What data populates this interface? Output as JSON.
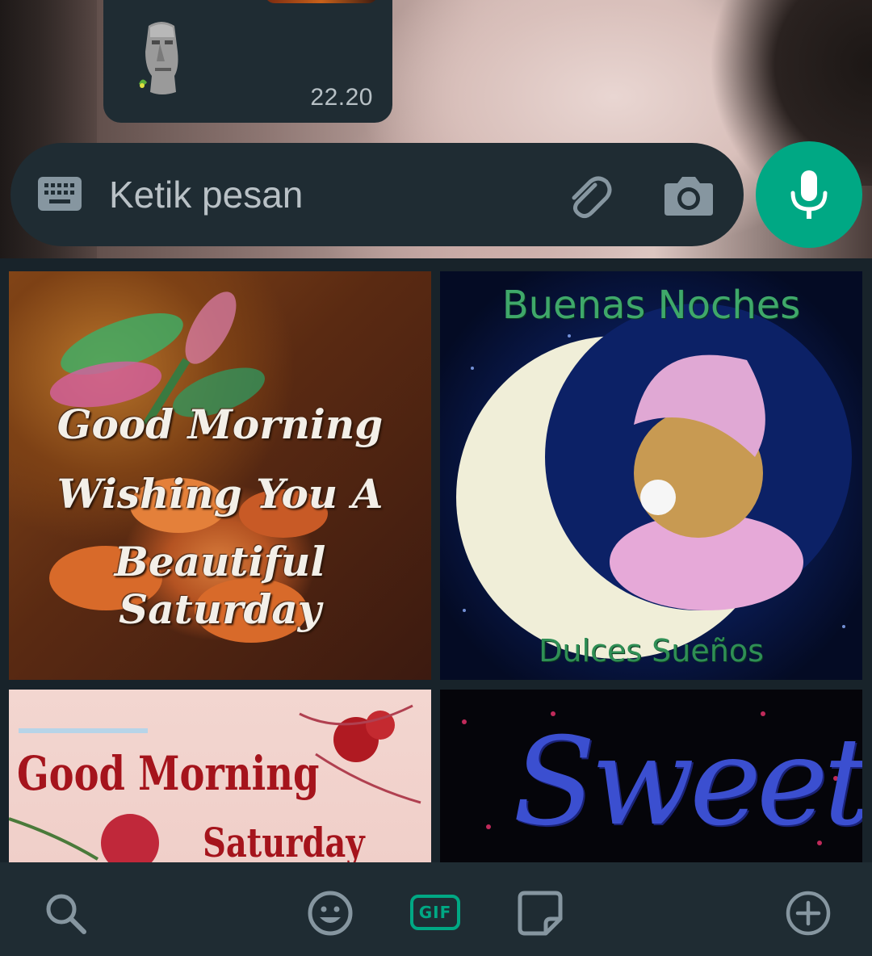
{
  "chat": {
    "message_time": "22.20"
  },
  "composer": {
    "placeholder": "Ketik pesan",
    "icons": [
      "keyboard-icon",
      "attach-icon",
      "camera-icon",
      "mic-icon"
    ]
  },
  "gifs": [
    {
      "lines": [
        "Good Morning",
        "Wishing You A",
        "Beautiful Saturday"
      ]
    },
    {
      "title": "Buenas Noches",
      "subtitle": "Dulces Sueños"
    },
    {
      "title": "Good Morning",
      "subtitle": "Saturday"
    },
    {
      "title": "Sweet"
    }
  ],
  "tabs": {
    "gif_label": "GIF",
    "items": [
      "search-icon",
      "emoji-icon",
      "gif-icon",
      "sticker-icon",
      "add-icon"
    ],
    "active": "gif-icon"
  },
  "colors": {
    "accent": "#00a884",
    "bubble": "#1f2c33",
    "panel": "#18232a",
    "icon": "#8696a0"
  }
}
